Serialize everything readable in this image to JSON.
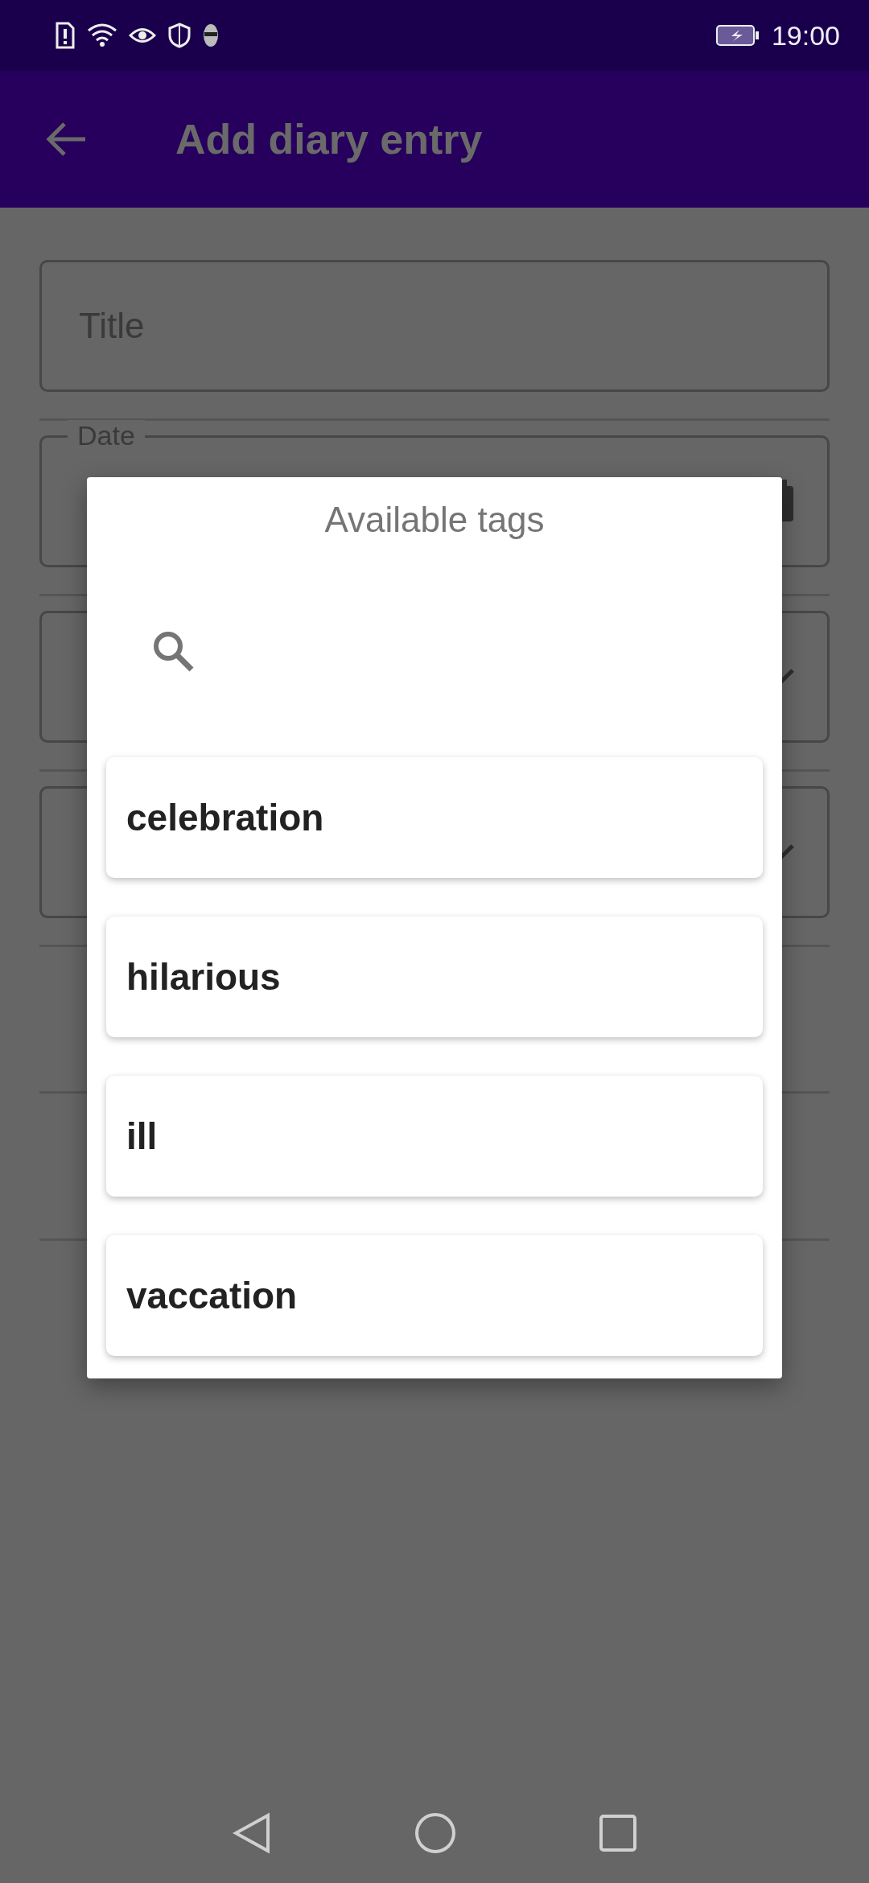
{
  "status_bar": {
    "time": "19:00"
  },
  "app_bar": {
    "title": "Add diary entry"
  },
  "form": {
    "fields": [
      {
        "kind": "text",
        "placeholder": "Title"
      },
      {
        "kind": "date",
        "label": "Date"
      },
      {
        "kind": "dropdown"
      },
      {
        "kind": "dropdown"
      }
    ]
  },
  "dialog": {
    "title": "Available tags",
    "tags": [
      {
        "label": "celebration"
      },
      {
        "label": "hilarious"
      },
      {
        "label": "ill"
      },
      {
        "label": "vaccation"
      }
    ]
  }
}
